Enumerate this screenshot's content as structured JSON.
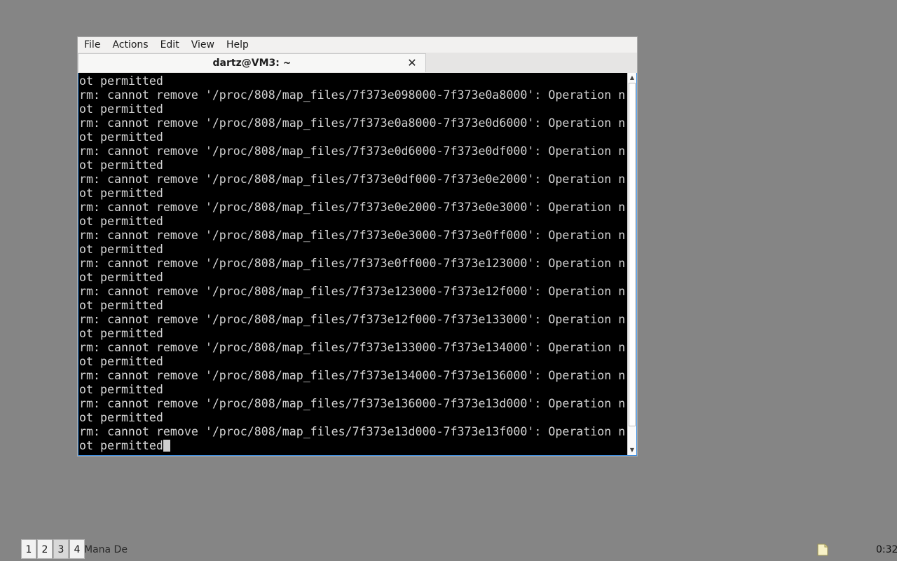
{
  "menubar": {
    "items": [
      "File",
      "Actions",
      "Edit",
      "View",
      "Help"
    ]
  },
  "tab": {
    "title": "dartz@VM3: ~",
    "close_icon": "close-icon"
  },
  "terminal": {
    "lines": [
      "ot permitted",
      "rm: cannot remove '/proc/808/map_files/7f373e098000-7f373e0a8000': Operation n",
      "ot permitted",
      "rm: cannot remove '/proc/808/map_files/7f373e0a8000-7f373e0d6000': Operation n",
      "ot permitted",
      "rm: cannot remove '/proc/808/map_files/7f373e0d6000-7f373e0df000': Operation n",
      "ot permitted",
      "rm: cannot remove '/proc/808/map_files/7f373e0df000-7f373e0e2000': Operation n",
      "ot permitted",
      "rm: cannot remove '/proc/808/map_files/7f373e0e2000-7f373e0e3000': Operation n",
      "ot permitted",
      "rm: cannot remove '/proc/808/map_files/7f373e0e3000-7f373e0ff000': Operation n",
      "ot permitted",
      "rm: cannot remove '/proc/808/map_files/7f373e0ff000-7f373e123000': Operation n",
      "ot permitted",
      "rm: cannot remove '/proc/808/map_files/7f373e123000-7f373e12f000': Operation n",
      "ot permitted",
      "rm: cannot remove '/proc/808/map_files/7f373e12f000-7f373e133000': Operation n",
      "ot permitted",
      "rm: cannot remove '/proc/808/map_files/7f373e133000-7f373e134000': Operation n",
      "ot permitted",
      "rm: cannot remove '/proc/808/map_files/7f373e134000-7f373e136000': Operation n",
      "ot permitted",
      "rm: cannot remove '/proc/808/map_files/7f373e136000-7f373e13d000': Operation n",
      "ot permitted",
      "rm: cannot remove '/proc/808/map_files/7f373e13d000-7f373e13f000': Operation n",
      "ot permitted"
    ]
  },
  "panel": {
    "desktops": [
      "1",
      "2",
      "3",
      "4"
    ],
    "active_desktop": "3",
    "task_label": "Mana Des",
    "clock": "0:32"
  },
  "colors": {
    "desktop_bg": "#858585",
    "terminal_bg": "#000000",
    "terminal_fg": "#d3d3d3",
    "focus_border": "#3d8ee0"
  }
}
